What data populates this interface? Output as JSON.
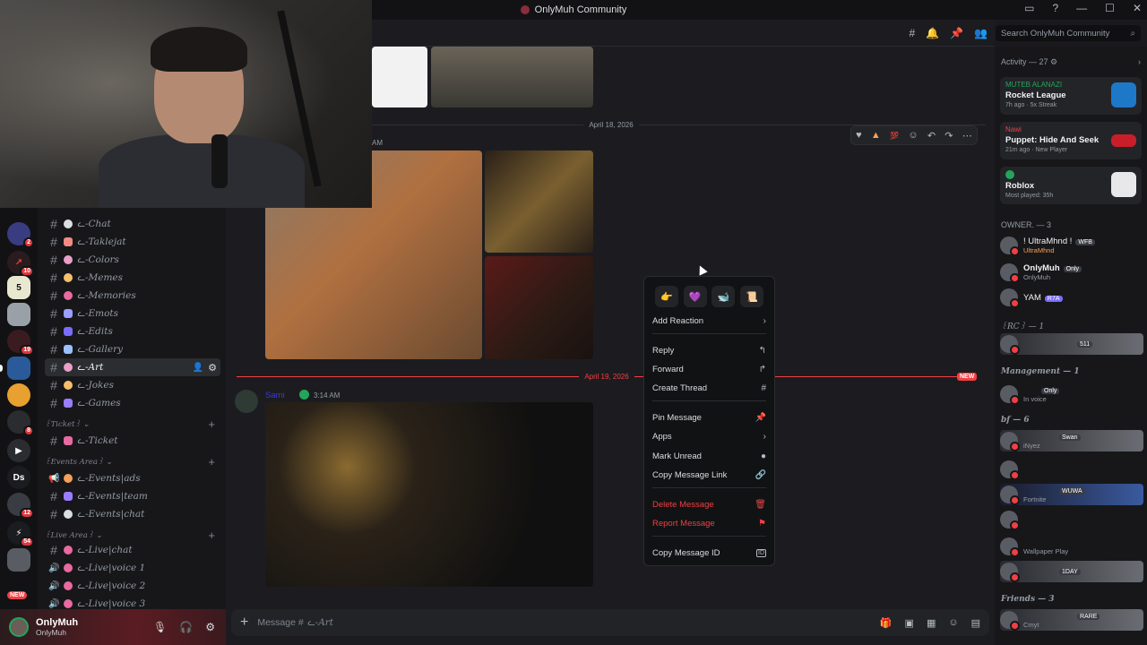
{
  "window": {
    "title": "OnlyMuh Community"
  },
  "search": {
    "placeholder": "Search OnlyMuh Community"
  },
  "server_badges": [
    "2",
    "10",
    "19",
    "8",
    "12",
    "54"
  ],
  "server_labels": {
    "ds": "Ds",
    "new": "NEW"
  },
  "channels": [
    {
      "name": "ᓚ-Chat",
      "color": "#dbdee1"
    },
    {
      "name": "ᓚ-Taklejat",
      "color": "#f28b82"
    },
    {
      "name": "ᓚ-Colors",
      "color": "#e8a0c8"
    },
    {
      "name": "ᓚ-Memes",
      "color": "#f5c06b"
    },
    {
      "name": "ᓚ-Memories",
      "color": "#e86aa0"
    },
    {
      "name": "ᓚ-Emots",
      "color": "#9aa0ff"
    },
    {
      "name": "ᓚ-Edits",
      "color": "#7a6cff"
    },
    {
      "name": "ᓚ-Gallery",
      "color": "#9ac0ff"
    },
    {
      "name": "ᓚ-Art",
      "color": "#e8a0c8"
    },
    {
      "name": "ᓚ-Jokes",
      "color": "#f5c06b"
    },
    {
      "name": "ᓚ-Games",
      "color": "#9a7cff"
    }
  ],
  "categories": {
    "ticket": "꒰Ticket꒱ ⌄",
    "events": "꒰Events Area꒱ ⌄",
    "live": "꒰Live Area꒱ ⌄"
  },
  "ticket_channels": [
    {
      "name": "ᓚ-Ticket",
      "color": "#e86aa0"
    }
  ],
  "event_channels": [
    {
      "name": "ᓚ-Events|ads",
      "color": "#f5a05b"
    },
    {
      "name": "ᓚ-Events|team",
      "color": "#9a7cff"
    },
    {
      "name": "ᓚ-Events|chat",
      "color": "#dbdee1"
    }
  ],
  "live_channels": [
    {
      "name": "ᓚ-Live|chat",
      "color": "#e86aa0"
    },
    {
      "name": "ᓚ-Live|voice 1",
      "color": "#e86aa0"
    },
    {
      "name": "ᓚ-Live|voice 2",
      "color": "#e86aa0"
    },
    {
      "name": "ᓚ-Live|voice 3",
      "color": "#e86aa0"
    }
  ],
  "user": {
    "name": "OnlyMuh",
    "status": "OnlyMuh"
  },
  "messages": {
    "date1": "April 18, 2026",
    "time1": "AM",
    "date2": "April 19, 2026",
    "new_badge": "NEW",
    "author2": "Sami",
    "time2": "3:14 AM"
  },
  "composer": {
    "placeholder": "Message #",
    "channel": "ᓚ-Art"
  },
  "context_menu": {
    "emojis": [
      "👉",
      "💜",
      "🐋",
      "📜"
    ],
    "items": [
      {
        "label": "Add Reaction",
        "icon": "›"
      },
      {
        "label": "Reply",
        "icon": "↰"
      },
      {
        "label": "Forward",
        "icon": "↱"
      },
      {
        "label": "Create Thread",
        "icon": "#"
      },
      {
        "label": "Pin Message",
        "icon": "📌"
      },
      {
        "label": "Apps",
        "icon": "›"
      },
      {
        "label": "Mark Unread",
        "icon": "●"
      },
      {
        "label": "Copy Message Link",
        "icon": "🔗"
      },
      {
        "label": "Delete Message",
        "icon": "🗑"
      },
      {
        "label": "Report Message",
        "icon": "⚑"
      },
      {
        "label": "Copy Message ID",
        "icon": "ID"
      }
    ]
  },
  "activity": {
    "header": "Activity — 27 ⚙",
    "cards": [
      {
        "who": "MUTEB ALANAZI",
        "who_color": "#23a55a",
        "game": "Rocket League",
        "meta": "7h ago · 5x Streak",
        "icon_color": "#1e78c8"
      },
      {
        "who": "Nawi",
        "who_color": "#f23f43",
        "game": "Puppet: Hide And Seek",
        "meta": "21m ago · New Player",
        "icon_color": "#c81e2a"
      },
      {
        "who": "",
        "who_color": "#23a55a",
        "game": "Roblox",
        "meta": "Most played: 35h",
        "icon_color": "#e8e8ea"
      }
    ]
  },
  "member_groups": [
    {
      "label": "OWNER. — 3",
      "members": [
        {
          "name": "! UltraMhnd !",
          "sub": "UltraMhnd",
          "tag": "WFB"
        },
        {
          "name": "OnlyMuh",
          "sub": "OnlyMuh",
          "tag": "Only"
        },
        {
          "name": "YAM",
          "sub": "",
          "tag": "R7A"
        }
      ]
    },
    {
      "label": "꒰RC꒱ — 1",
      "members": [
        {
          "name": "",
          "sub": "",
          "tag": "511"
        }
      ]
    },
    {
      "label": "Management — 1",
      "members": [
        {
          "name": "",
          "sub": "In voice",
          "tag": "Only"
        }
      ]
    },
    {
      "label": "bf — 6",
      "members": [
        {
          "name": "",
          "sub": "iNyez",
          "tag": "Swan"
        },
        {
          "name": "",
          "sub": "",
          "tag": ""
        },
        {
          "name": "",
          "sub": "Fortnite",
          "tag": "WUWA"
        },
        {
          "name": "",
          "sub": "",
          "tag": ""
        },
        {
          "name": "",
          "sub": "Wallpaper Play",
          "tag": ""
        },
        {
          "name": "",
          "sub": "",
          "tag": "1DAY"
        }
      ]
    },
    {
      "label": "Friends — 3",
      "members": [
        {
          "name": "",
          "sub": "Cmyt",
          "tag": "RARE"
        }
      ]
    }
  ]
}
